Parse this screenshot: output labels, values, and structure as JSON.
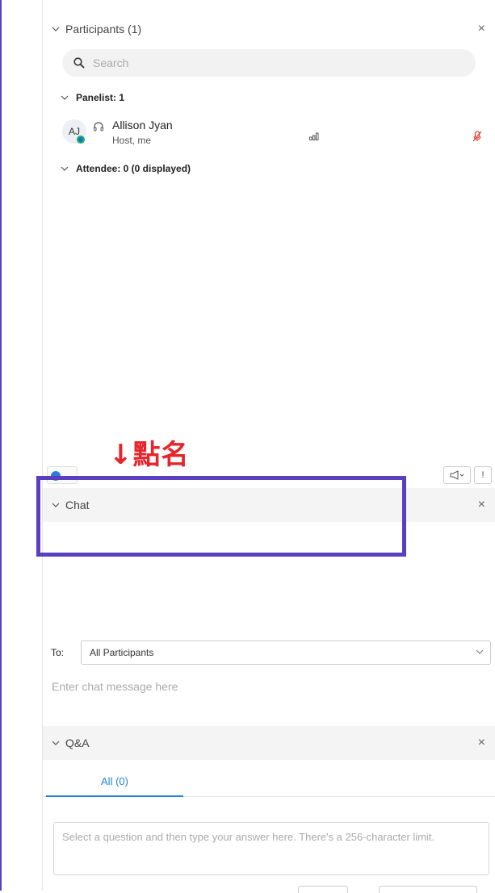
{
  "participants": {
    "title": "Participants (1)",
    "search_placeholder": "Search",
    "panelist_group": "Panelist: 1",
    "attendee_group": "Attendee: 0 (0 displayed)",
    "list": [
      {
        "initials": "AJ",
        "name": "Allison Jyan",
        "role": "Host, me"
      }
    ],
    "close": "×"
  },
  "annotation": {
    "text": "↓點名",
    "color": "#e8232a",
    "box_color": "#5a3fc0"
  },
  "toolbar": {
    "exclaim": "!"
  },
  "chat": {
    "title": "Chat",
    "close": "×",
    "to_label": "To:",
    "to_value": "All Participants",
    "input_placeholder": "Enter chat message here"
  },
  "qa": {
    "title": "Q&A",
    "close": "×",
    "tab_all": "All (0)",
    "answer_placeholder": "Select a question and then type your answer here. There's a 256-character limit."
  },
  "colors": {
    "accent": "#1f84d6",
    "mute_red": "#e23b2e",
    "frame": "#5a3fc0"
  }
}
